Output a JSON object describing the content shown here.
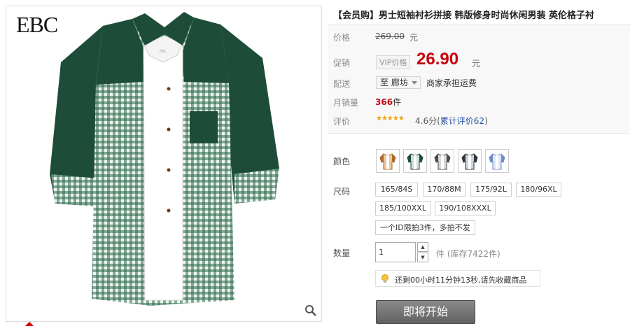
{
  "brand": "EBC",
  "product": {
    "title": "【会员购】男士短袖衬衫拼接 韩版修身时尚休闲男装 英伦格子衬"
  },
  "labels": {
    "price": "价格",
    "promo": "促销",
    "ship": "配送",
    "monthly_sales": "月销量",
    "rating": "评价",
    "color": "颜色",
    "size": "尺码",
    "quantity": "数量"
  },
  "price": {
    "original": "269.00",
    "currency_unit": "元",
    "vip_tag": "VIP价格",
    "promo": "26.90"
  },
  "shipping": {
    "destination": "至 廊坊",
    "note": "商家承担运费"
  },
  "sales": {
    "count": "366",
    "unit": "件"
  },
  "rating": {
    "stars": "★★★★★",
    "score": "4.6分",
    "reviews_prefix": "(",
    "reviews_link": "累计评价62",
    "reviews_suffix": ")"
  },
  "colors": [
    {
      "shirt": "#b06a2a",
      "check": "#e8c9a0"
    },
    {
      "shirt": "#1e4a3a",
      "check": "#cfe0d6"
    },
    {
      "shirt": "#4a4a4a",
      "check": "#d8d8d8"
    },
    {
      "shirt": "#2e3440",
      "check": "#cfd3da"
    },
    {
      "shirt": "#6c8cc8",
      "check": "#dfe7f5"
    }
  ],
  "sizes": [
    "165/84S",
    "170/88M",
    "175/92L",
    "180/96XL",
    "185/100XXL",
    "190/108XXXL"
  ],
  "limit_note": "一个ID限拍3件，多拍不发",
  "quantity": {
    "value": "1",
    "stock": "件 (库存7422件)"
  },
  "countdown": "还剩00小时11分钟13秒,请先收藏商品",
  "buy_button": "即将开始",
  "accent": "#c8000a"
}
